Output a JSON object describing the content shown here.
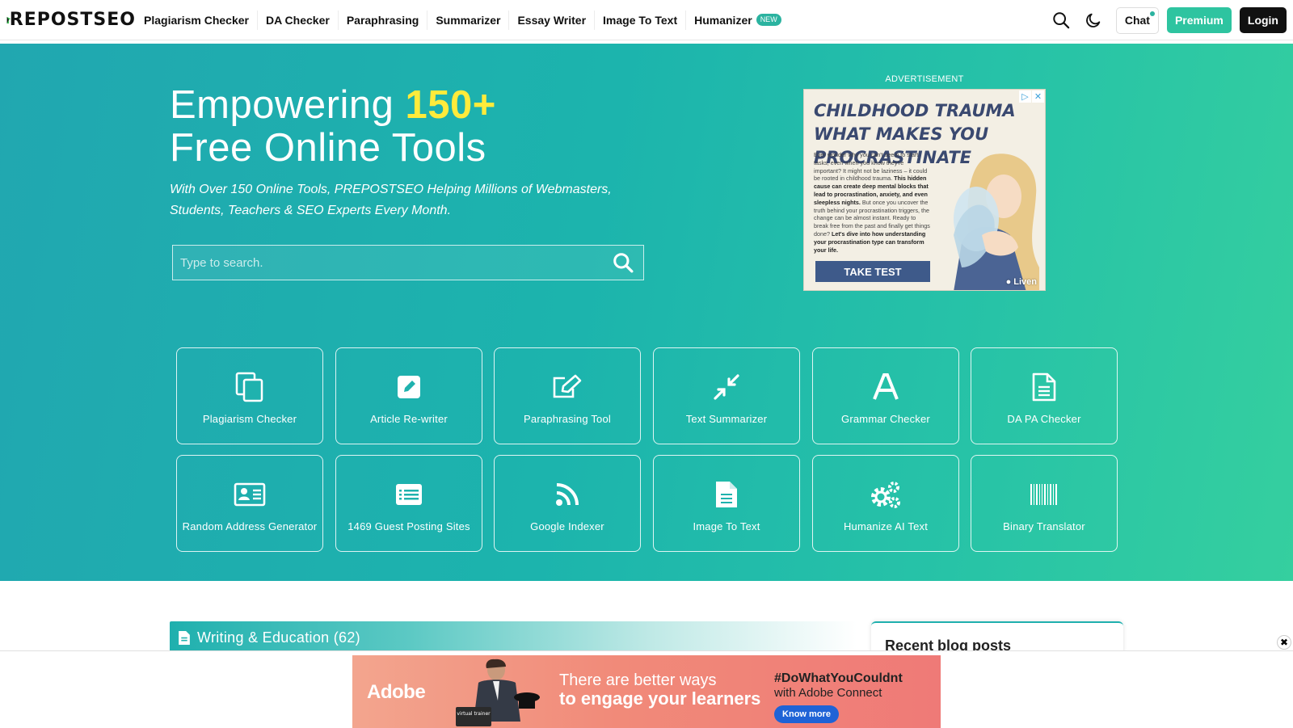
{
  "header": {
    "logo_text": "REPOSTSEO",
    "nav": [
      {
        "label": "Plagiarism Checker"
      },
      {
        "label": "DA Checker"
      },
      {
        "label": "Paraphrasing"
      },
      {
        "label": "Summarizer"
      },
      {
        "label": "Essay Writer"
      },
      {
        "label": "Image To Text"
      },
      {
        "label": "Humanizer",
        "badge": "NEW"
      }
    ],
    "chat_label": "Chat",
    "premium_label": "Premium",
    "login_label": "Login"
  },
  "hero": {
    "title_prefix": "Empowering ",
    "title_highlight": "150+",
    "title_line2": "Free Online Tools",
    "subtitle": "With Over 150 Online Tools, PREPOSTSEO Helping Millions of Webmasters, Students, Teachers & SEO Experts Every Month.",
    "search_placeholder": "Type to search."
  },
  "advert": {
    "label": "ADVERTISEMENT",
    "headline": "CHILDHOOD TRAUMA WHAT MAKES YOU PROCRASTINATE",
    "body_plain": "Ever wonder why you can't seem to start tasks, even when you know they're important? It might not be laziness – it could be rooted in childhood trauma. ",
    "body_bold1": "This hidden cause can create deep mental blocks that lead to procrastination, anxiety, and even sleepless nights.",
    "body_plain2": " But once you uncover the truth behind your procrastination triggers, the change can be almost instant. Ready to break free from the past and finally get things done? ",
    "body_bold2": "Let's dive into how understanding your procrastination type can transform your life.",
    "cta": "TAKE TEST",
    "brand": "Liven"
  },
  "tools": [
    {
      "label": "Plagiarism Checker",
      "icon": "copy-icon"
    },
    {
      "label": "Article Re-writer",
      "icon": "pencil-square-icon"
    },
    {
      "label": "Paraphrasing Tool",
      "icon": "edit-icon"
    },
    {
      "label": "Text Summarizer",
      "icon": "compress-icon"
    },
    {
      "label": "Grammar Checker",
      "icon": "font-icon"
    },
    {
      "label": "DA PA Checker",
      "icon": "file-text-icon"
    },
    {
      "label": "Random Address Generator",
      "icon": "address-card-icon"
    },
    {
      "label": "1469 Guest Posting Sites",
      "icon": "list-alt-icon"
    },
    {
      "label": "Google Indexer",
      "icon": "rss-icon"
    },
    {
      "label": "Image To Text",
      "icon": "file-doc-icon"
    },
    {
      "label": "Humanize AI Text",
      "icon": "gears-icon"
    },
    {
      "label": "Binary Translator",
      "icon": "barcode-icon"
    }
  ],
  "section": {
    "title": "Writing & Education (62)",
    "blog_title": "Recent blog posts"
  },
  "bottom_ad": {
    "brand": "Adobe",
    "line1": "There are better ways",
    "line2": "to engage your learners",
    "hashtag": "#DoWhatYouCouldnt",
    "with": "with Adobe Connect",
    "button": "Know more",
    "badge": "virtual trainer"
  },
  "colors": {
    "accent": "#2ec4a0",
    "highlight": "#ffeb3b",
    "hero_start": "#21a7b0",
    "hero_end": "#35cf9f"
  }
}
